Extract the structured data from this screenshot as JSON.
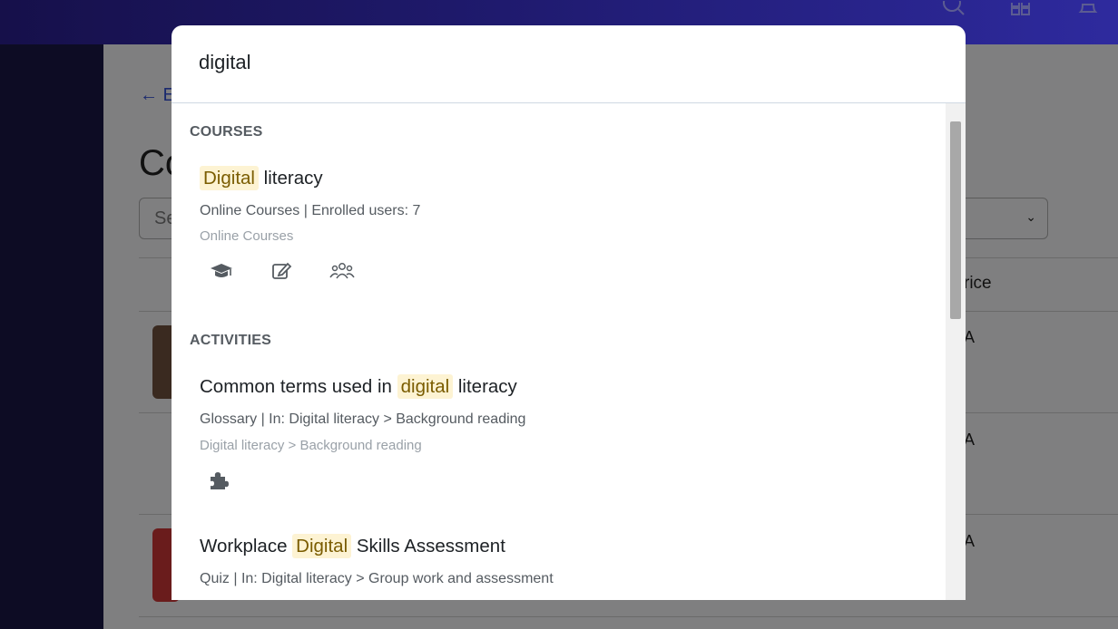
{
  "background": {
    "back_label": "← E",
    "page_title": "Co",
    "search_placeholder": "Se",
    "price_header": "rice",
    "na_values": [
      "A",
      "A",
      "A"
    ]
  },
  "modal": {
    "query": "digital",
    "sections": {
      "courses": "COURSES",
      "activities": "ACTIVITIES"
    },
    "course_1": {
      "title_hl": "Digital",
      "title_rest": " literacy",
      "meta": "Online Courses | Enrolled users: 7",
      "path": "Online Courses",
      "actions": [
        "graduation-cap-icon",
        "edit-icon",
        "users-icon"
      ]
    },
    "activity_1": {
      "title_pre": "Common terms used in ",
      "title_hl": "digital",
      "title_post": " literacy",
      "meta": "Glossary | In: Digital literacy > Background reading",
      "path": "Digital literacy > Background reading",
      "actions": [
        "puzzle-icon"
      ]
    },
    "activity_2": {
      "title_pre": "Workplace ",
      "title_hl": "Digital",
      "title_post": " Skills Assessment",
      "meta": "Quiz | In: Digital literacy > Group work and assessment"
    }
  },
  "colors": {
    "highlight_bg": "#fdf3d3",
    "highlight_text": "#7a5c00",
    "topbar_start": "#16104a",
    "topbar_end": "#2e2a9e"
  }
}
